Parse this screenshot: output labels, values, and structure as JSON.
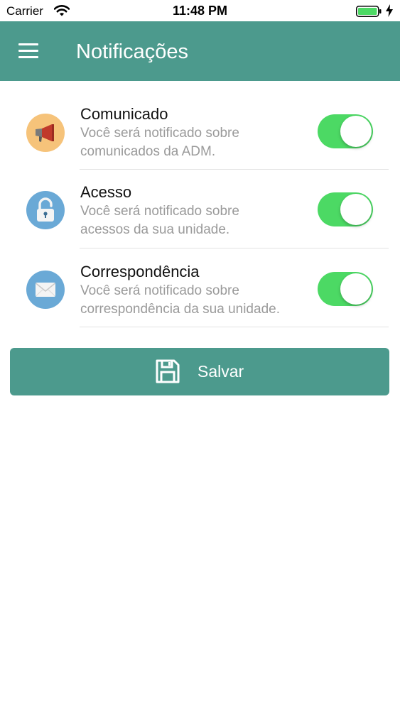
{
  "status_bar": {
    "carrier": "Carrier",
    "time": "11:48 PM",
    "battery_color": "#4cd964"
  },
  "header": {
    "title": "Notificações",
    "background_color": "#4c9a8d",
    "menu_icon": "hamburger-menu-icon"
  },
  "settings": [
    {
      "title": "Comunicado",
      "description_line1": "Você será notificado sobre",
      "description_line2": "comunicados da ADM.",
      "icon": "megaphone-icon",
      "enabled": true
    },
    {
      "title": "Acesso",
      "description_line1": "Você será notificado sobre",
      "description_line2": "acessos da sua unidade.",
      "icon": "padlock-icon",
      "enabled": true
    },
    {
      "title": "Correspondência",
      "description_line1": "Você será notificado sobre",
      "description_line2": "correspondência da sua unidade.",
      "icon": "envelope-icon",
      "enabled": true
    }
  ],
  "save_button": {
    "label": "Salvar",
    "icon": "floppy-disk-icon"
  },
  "colors": {
    "accent": "#4c9a8d",
    "toggle_on": "#4cd964",
    "description_text": "#9a9a9a"
  }
}
